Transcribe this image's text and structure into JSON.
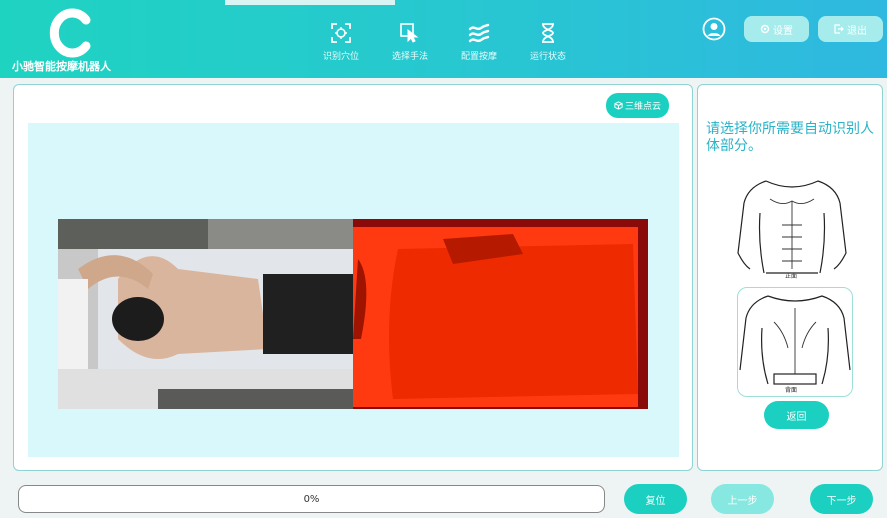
{
  "header": {
    "app_name": "小驰智能按摩机器人",
    "nav": [
      {
        "label": "识别穴位",
        "icon": "scan-icon"
      },
      {
        "label": "选择手法",
        "icon": "hand-pointer-icon"
      },
      {
        "label": "配置按摩",
        "icon": "wave-icon"
      },
      {
        "label": "运行状态",
        "icon": "hourglass-icon"
      }
    ],
    "settings_label": "设置",
    "logout_label": "退出"
  },
  "main": {
    "point_cloud_label": "三维点云"
  },
  "side": {
    "prompt": "请选择你所需要自动识别人体部分。",
    "front_label": "正面",
    "back_label": "背面",
    "return_label": "返回"
  },
  "footer": {
    "progress": 0,
    "progress_text": "0%",
    "reset_label": "复位",
    "prev_label": "上一步",
    "next_label": "下一步"
  },
  "colors": {
    "accent": "#1bd0c0",
    "accent_light": "#86e8e0",
    "view_bg": "#d9f8fb",
    "depth_red": "#ff2a00"
  }
}
